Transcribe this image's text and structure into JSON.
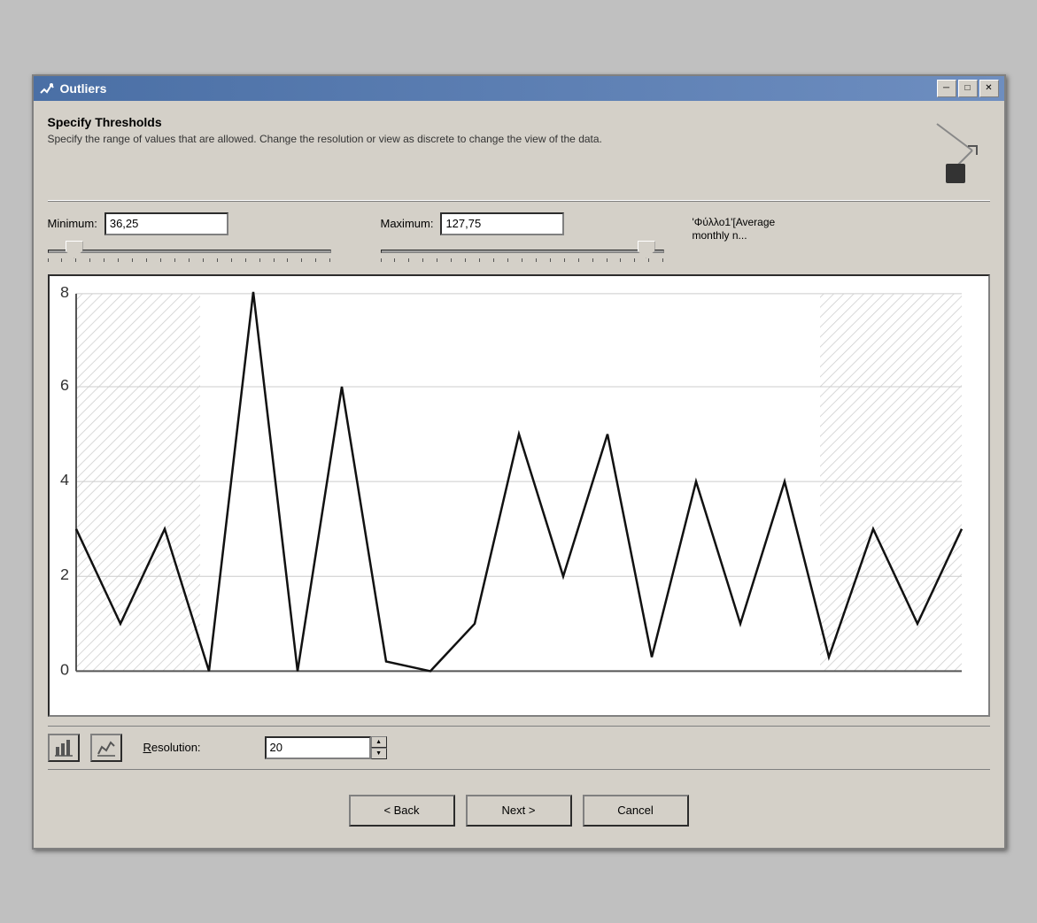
{
  "window": {
    "title": "Outliers",
    "min_btn": "─",
    "max_btn": "□",
    "close_btn": "✕"
  },
  "header": {
    "title": "Specify Thresholds",
    "description": "Specify the range of values that are allowed.  Change the resolution or view as discrete to change the view of the data."
  },
  "controls": {
    "minimum_label": "Minimum:",
    "minimum_value": "36,25",
    "maximum_label": "Maximum:",
    "maximum_value": "127,75",
    "field_label": "'Φύλλο1'[Average monthly  n..."
  },
  "chart": {
    "y_labels": [
      "0",
      "2",
      "4",
      "6",
      "8"
    ],
    "x_min": 0,
    "x_max": 20
  },
  "bottom_controls": {
    "resolution_label": "Resolution:",
    "resolution_value": "20"
  },
  "footer": {
    "back_label": "< Back",
    "next_label": "Next >",
    "cancel_label": "Cancel"
  }
}
